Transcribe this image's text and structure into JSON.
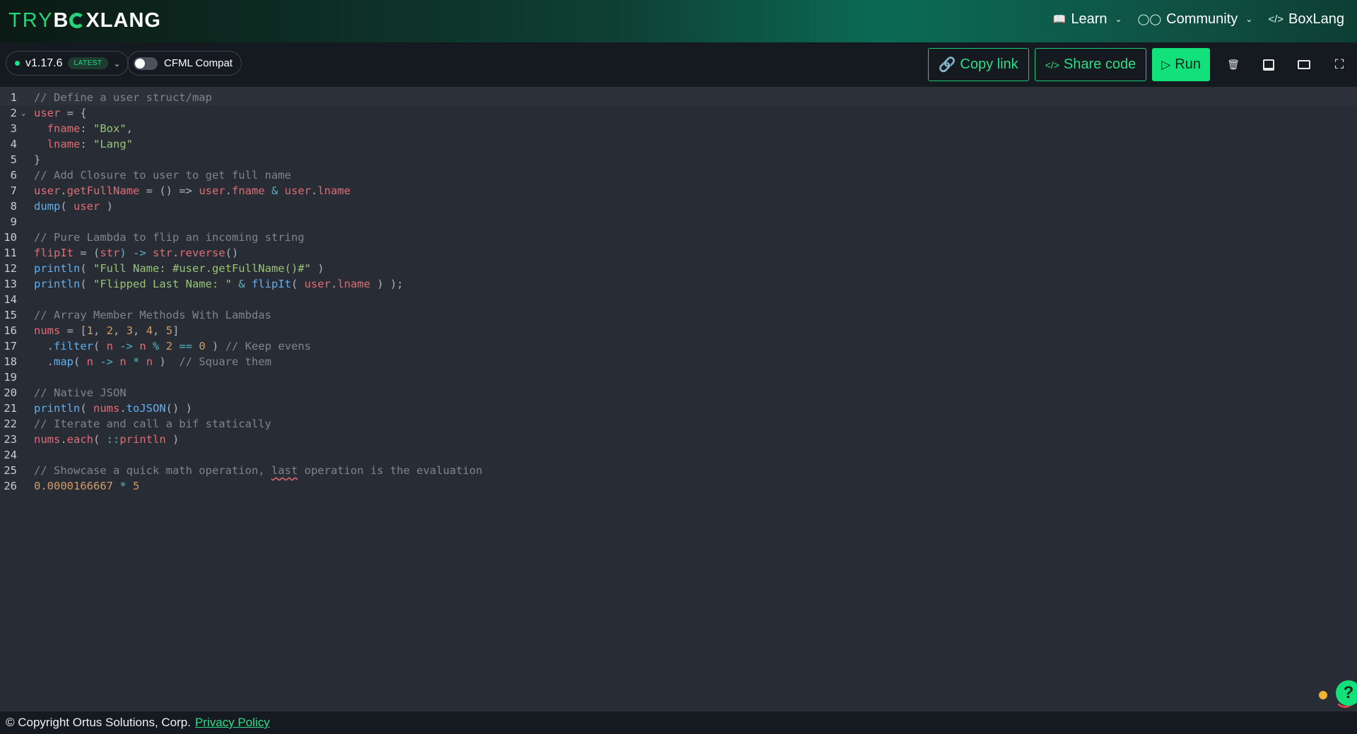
{
  "brand": {
    "try": "TRY",
    "b": "B",
    "rest": "XLANG"
  },
  "nav": {
    "learn": "Learn",
    "community": "Community",
    "boxlang": "BoxLang"
  },
  "toolbar": {
    "version": "v1.17.6",
    "latest_badge": "LATEST",
    "cfml_compat": "CFML Compat",
    "copy_link": "Copy link",
    "share_code": "Share code",
    "run": "Run"
  },
  "editor": {
    "lines": [
      {
        "n": "1"
      },
      {
        "n": "2"
      },
      {
        "n": "3"
      },
      {
        "n": "4"
      },
      {
        "n": "5"
      },
      {
        "n": "6"
      },
      {
        "n": "7"
      },
      {
        "n": "8"
      },
      {
        "n": "9"
      },
      {
        "n": "10"
      },
      {
        "n": "11"
      },
      {
        "n": "12"
      },
      {
        "n": "13"
      },
      {
        "n": "14"
      },
      {
        "n": "15"
      },
      {
        "n": "16"
      },
      {
        "n": "17"
      },
      {
        "n": "18"
      },
      {
        "n": "19"
      },
      {
        "n": "20"
      },
      {
        "n": "21"
      },
      {
        "n": "22"
      },
      {
        "n": "23"
      },
      {
        "n": "24"
      },
      {
        "n": "25"
      },
      {
        "n": "26"
      }
    ],
    "tokens": {
      "l1": "// Define a user struct/map",
      "l2a": "user",
      "l2b": " = {",
      "l3a": "  fname",
      "l3b": ": ",
      "l3c": "\"Box\"",
      "l3d": ",",
      "l4a": "  lname",
      "l4b": ": ",
      "l4c": "\"Lang\"",
      "l5": "}",
      "l6": "// Add Closure to user to get full name",
      "l7a": "user",
      "l7b": ".",
      "l7c": "getFullName",
      "l7d": " = () => ",
      "l7e": "user",
      "l7f": ".",
      "l7g": "fname",
      "l7h": " & ",
      "l7i": "user",
      "l7j": ".",
      "l7k": "lname",
      "l8a": "dump",
      "l8b": "( ",
      "l8c": "user",
      "l8d": " )",
      "l10": "// Pure Lambda to flip an incoming string",
      "l11a": "flipIt",
      "l11b": " = (",
      "l11c": "str",
      "l11d": ") -> ",
      "l11e": "str",
      "l11f": ".",
      "l11g": "reverse",
      "l11h": "()",
      "l12a": "println",
      "l12b": "( ",
      "l12c": "\"Full Name: #user.getFullName()#\"",
      "l12d": " )",
      "l13a": "println",
      "l13b": "( ",
      "l13c": "\"Flipped Last Name: \"",
      "l13d": " & ",
      "l13e": "flipIt",
      "l13f": "( ",
      "l13g": "user",
      "l13h": ".",
      "l13i": "lname",
      "l13j": " ) );",
      "l15": "// Array Member Methods With Lambdas",
      "l16a": "nums",
      "l16b": " = [",
      "l16c": "1",
      "l16d": ", ",
      "l16e": "2",
      "l16f": ", ",
      "l16g": "3",
      "l16h": ", ",
      "l16i": "4",
      "l16j": ", ",
      "l16k": "5",
      "l16l": "]",
      "l17a": "  .",
      "l17b": "filter",
      "l17c": "( ",
      "l17d": "n",
      "l17e": " -> ",
      "l17f": "n",
      "l17g": " % ",
      "l17h": "2",
      "l17i": " == ",
      "l17j": "0",
      "l17k": " ) ",
      "l17l": "// Keep evens",
      "l18a": "  .",
      "l18b": "map",
      "l18c": "( ",
      "l18d": "n",
      "l18e": " -> ",
      "l18f": "n",
      "l18g": " * ",
      "l18h": "n",
      "l18i": " )  ",
      "l18j": "// Square them",
      "l20": "// Native JSON",
      "l21a": "println",
      "l21b": "( ",
      "l21c": "nums",
      "l21d": ".",
      "l21e": "toJSON",
      "l21f": "() )",
      "l22": "// Iterate and call a bif statically",
      "l23a": "nums",
      "l23b": ".",
      "l23c": "each",
      "l23d": "( ",
      "l23e": "::",
      "l23f": "println",
      "l23g": " )",
      "l25a": "// Showcase a quick math operation, ",
      "l25b": "last",
      "l25c": " operation is the evaluation",
      "l26a": "0.0000166667",
      "l26b": " * ",
      "l26c": "5"
    }
  },
  "help": {
    "label": "?"
  },
  "footer": {
    "copyright": "© Copyright Ortus Solutions, Corp.",
    "privacy": "Privacy Policy"
  },
  "colors": {
    "accent": "#12e07a",
    "bg": "#282c34",
    "toolbar": "#151a20"
  }
}
